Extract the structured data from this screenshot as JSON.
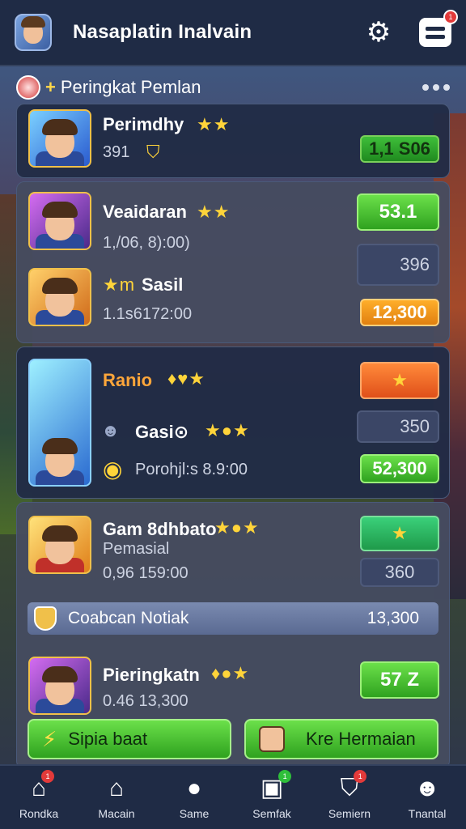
{
  "header": {
    "title": "Nasaplatin Inalvain",
    "settings_icon": "gear-icon",
    "menu_icon": "menu-icon",
    "menu_badge": "1"
  },
  "section": {
    "title": "Peringkat Pemlan"
  },
  "cards": {
    "c1": {
      "name": "Perimdhy",
      "stars": "★★",
      "sub": "391",
      "pill": "1,1 S06"
    },
    "c2": {
      "name": "Veaidaran",
      "stars": "★★",
      "sub": "1,/06, 8):00)",
      "pill": "53.1"
    },
    "c2b": {
      "name_prefix": "★m",
      "name": "Sasil",
      "sub": "1.1s6172:00",
      "slate": "396",
      "pill": "12,300"
    },
    "c3": {
      "name": "Ranio",
      "stars": "♦♥★",
      "pill": "★"
    },
    "c3b": {
      "name": "Gasi⊙",
      "stars": "★●★",
      "slate": "350",
      "sub": "Porohjl:s 8.9:00",
      "pill": "52,300"
    },
    "c4": {
      "name": "Gam 8dhbato",
      "stars": "★●★",
      "sub1": "Pemasial",
      "sub2": "0,96 159:00",
      "pill": "★",
      "slate": "360"
    },
    "notice": {
      "label": "Coabcan Notiak",
      "value": "13,300"
    },
    "c5": {
      "name": "Pieringkatn",
      "stars": "♦●★",
      "sub": "0.46 13,300",
      "pill": "57 Z"
    }
  },
  "buttons": {
    "left": "Sipia baat",
    "right": "Kre Hermaian"
  },
  "nav": [
    {
      "label": "Rondka",
      "icon": "home-icon",
      "badge": "1"
    },
    {
      "label": "Macain",
      "icon": "house-icon",
      "badge": ""
    },
    {
      "label": "Same",
      "icon": "game-icon",
      "badge": ""
    },
    {
      "label": "Semfak",
      "icon": "cards-icon",
      "badge": "1"
    },
    {
      "label": "Semiern",
      "icon": "shield-icon",
      "badge": "1"
    },
    {
      "label": "Tnantal",
      "icon": "profile-icon",
      "badge": ""
    }
  ]
}
